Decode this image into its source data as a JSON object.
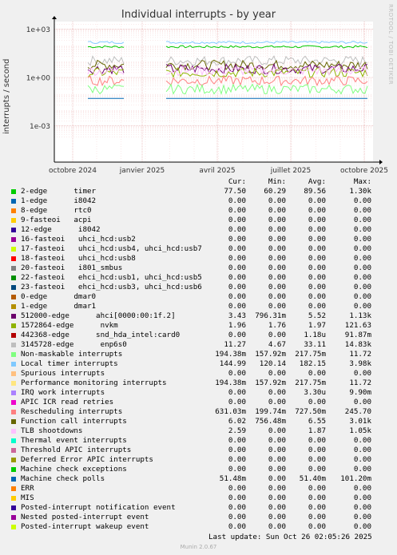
{
  "chart_data": {
    "type": "line",
    "title": "Individual interrupts - by year",
    "ylabel": "interrupts / second",
    "yscale": "log",
    "yticks": [
      "1e+03",
      "1e+00",
      "1e-03"
    ],
    "xticks": [
      "octobre 2024",
      "janvier 2025",
      "avril 2025",
      "juillet 2025",
      "octobre 2025"
    ],
    "grid": true,
    "columns": [
      "Cur:",
      "Min:",
      "Avg:",
      "Max:"
    ],
    "series": [
      {
        "name": "2-edge      timer",
        "color": "#00cc00",
        "values": [
          "77.50",
          "60.29",
          "89.56",
          "1.30k"
        ]
      },
      {
        "name": "1-edge      i8042",
        "color": "#0066b3",
        "values": [
          "0.00",
          "0.00",
          "0.00",
          "0.00"
        ]
      },
      {
        "name": "8-edge      rtc0",
        "color": "#ff8000",
        "values": [
          "0.00",
          "0.00",
          "0.00",
          "0.00"
        ]
      },
      {
        "name": "9-fasteoi   acpi",
        "color": "#ffcc00",
        "values": [
          "0.00",
          "0.00",
          "0.00",
          "0.00"
        ]
      },
      {
        "name": "12-edge      i8042",
        "color": "#330099",
        "values": [
          "0.00",
          "0.00",
          "0.00",
          "0.00"
        ]
      },
      {
        "name": "16-fasteoi   uhci_hcd:usb2",
        "color": "#990099",
        "values": [
          "0.00",
          "0.00",
          "0.00",
          "0.00"
        ]
      },
      {
        "name": "17-fasteoi   uhci_hcd:usb4, uhci_hcd:usb7",
        "color": "#ccff00",
        "values": [
          "0.00",
          "0.00",
          "0.00",
          "0.00"
        ]
      },
      {
        "name": "18-fasteoi   uhci_hcd:usb8",
        "color": "#ff0000",
        "values": [
          "0.00",
          "0.00",
          "0.00",
          "0.00"
        ]
      },
      {
        "name": "20-fasteoi   i801_smbus",
        "color": "#808080",
        "values": [
          "0.00",
          "0.00",
          "0.00",
          "0.00"
        ]
      },
      {
        "name": "22-fasteoi   ehci_hcd:usb1, uhci_hcd:usb5",
        "color": "#008f00",
        "values": [
          "0.00",
          "0.00",
          "0.00",
          "0.00"
        ]
      },
      {
        "name": "23-fasteoi   ehci_hcd:usb3, uhci_hcd:usb6",
        "color": "#00487d",
        "values": [
          "0.00",
          "0.00",
          "0.00",
          "0.00"
        ]
      },
      {
        "name": "0-edge      dmar0",
        "color": "#b35a00",
        "values": [
          "0.00",
          "0.00",
          "0.00",
          "0.00"
        ]
      },
      {
        "name": "1-edge      dmar1",
        "color": "#b38f00",
        "values": [
          "0.00",
          "0.00",
          "0.00",
          "0.00"
        ]
      },
      {
        "name": "512000-edge      ahci[0000:00:1f.2]",
        "color": "#6b006b",
        "values": [
          "3.43",
          "796.31m",
          "5.52",
          "1.13k"
        ]
      },
      {
        "name": "1572864-edge      nvkm",
        "color": "#8fb300",
        "values": [
          "1.96",
          "1.76",
          "1.97",
          "121.63"
        ]
      },
      {
        "name": "442368-edge      snd_hda_intel:card0",
        "color": "#b30000",
        "values": [
          "0.00",
          "0.00",
          "1.18u",
          "91.87m"
        ]
      },
      {
        "name": "3145728-edge      enp6s0",
        "color": "#bebebe",
        "values": [
          "11.27",
          "4.67",
          "33.11",
          "14.83k"
        ]
      },
      {
        "name": "Non-maskable interrupts",
        "color": "#80ff80",
        "values": [
          "194.38m",
          "157.92m",
          "217.75m",
          "11.72"
        ]
      },
      {
        "name": "Local timer interrupts",
        "color": "#80c9ff",
        "values": [
          "144.99",
          "120.14",
          "182.15",
          "3.98k"
        ]
      },
      {
        "name": "Spurious interrupts",
        "color": "#ffc080",
        "values": [
          "0.00",
          "0.00",
          "0.00",
          "0.00"
        ]
      },
      {
        "name": "Performance monitoring interrupts",
        "color": "#ffe680",
        "values": [
          "194.38m",
          "157.92m",
          "217.75m",
          "11.72"
        ]
      },
      {
        "name": "IRQ work interrupts",
        "color": "#aa80ff",
        "values": [
          "0.00",
          "0.00",
          "3.30u",
          "9.90m"
        ]
      },
      {
        "name": "APIC ICR read retries",
        "color": "#ee00cc",
        "values": [
          "0.00",
          "0.00",
          "0.00",
          "0.00"
        ]
      },
      {
        "name": "Rescheduling interrupts",
        "color": "#ff8080",
        "values": [
          "631.03m",
          "199.74m",
          "727.50m",
          "245.70"
        ]
      },
      {
        "name": "Function call interrupts",
        "color": "#666600",
        "values": [
          "6.02",
          "756.48m",
          "6.55",
          "3.01k"
        ]
      },
      {
        "name": "TLB shootdowns",
        "color": "#ffbfff",
        "values": [
          "2.59",
          "0.00",
          "1.87",
          "1.05k"
        ]
      },
      {
        "name": "Thermal event interrupts",
        "color": "#00ffcc",
        "values": [
          "0.00",
          "0.00",
          "0.00",
          "0.00"
        ]
      },
      {
        "name": "Threshold APIC interrupts",
        "color": "#cc6699",
        "values": [
          "0.00",
          "0.00",
          "0.00",
          "0.00"
        ]
      },
      {
        "name": "Deferred Error APIC interrupts",
        "color": "#999900",
        "values": [
          "0.00",
          "0.00",
          "0.00",
          "0.00"
        ]
      },
      {
        "name": "Machine check exceptions",
        "color": "#00cc00",
        "values": [
          "0.00",
          "0.00",
          "0.00",
          "0.00"
        ]
      },
      {
        "name": "Machine check polls",
        "color": "#0066b3",
        "values": [
          "51.48m",
          "0.00",
          "51.40m",
          "101.20m"
        ]
      },
      {
        "name": "ERR",
        "color": "#ff8000",
        "values": [
          "0.00",
          "0.00",
          "0.00",
          "0.00"
        ]
      },
      {
        "name": "MIS",
        "color": "#ffcc00",
        "values": [
          "0.00",
          "0.00",
          "0.00",
          "0.00"
        ]
      },
      {
        "name": "Posted-interrupt notification event",
        "color": "#330099",
        "values": [
          "0.00",
          "0.00",
          "0.00",
          "0.00"
        ]
      },
      {
        "name": "Nested posted-interrupt event",
        "color": "#990099",
        "values": [
          "0.00",
          "0.00",
          "0.00",
          "0.00"
        ]
      },
      {
        "name": "Posted-interrupt wakeup event",
        "color": "#ccff00",
        "values": [
          "0.00",
          "0.00",
          "0.00",
          "0.00"
        ]
      }
    ],
    "approx_levels": [
      {
        "color": "#00cc00",
        "level": 80
      },
      {
        "color": "#80c9ff",
        "level": 150
      },
      {
        "color": "#bebebe",
        "level": 11
      },
      {
        "color": "#666600",
        "level": 6
      },
      {
        "color": "#6b006b",
        "level": 3.4
      },
      {
        "color": "#8fb300",
        "level": 2
      },
      {
        "color": "#ffbfff",
        "level": 2.6
      },
      {
        "color": "#ff8080",
        "level": 0.63
      },
      {
        "color": "#80ff80",
        "level": 0.19
      },
      {
        "color": "#0066b3",
        "level": 0.05
      }
    ]
  },
  "side_label": "RRDTOOL / TOBI OETIKER",
  "last_update": "Last update: Sun Oct 26 02:05:26 2025",
  "version": "Munin 2.0.67"
}
